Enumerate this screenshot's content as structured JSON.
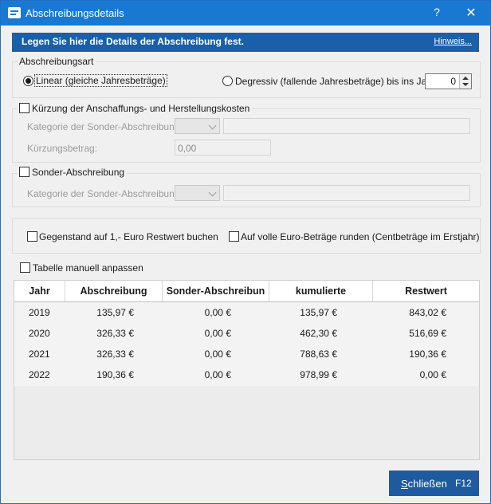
{
  "window": {
    "title": "Abschreibungsdetails",
    "help_label": "?",
    "close_label": "✕",
    "app_icon": "window-app-icon"
  },
  "banner": {
    "text": "Legen Sie hier die Details der Abschreibung fest.",
    "link": "Hinweis..."
  },
  "abschreibungsart": {
    "legend": "Abschreibungsart",
    "linear_label": "Linear (gleiche Jahresbeträge)",
    "linear_checked": true,
    "degressiv_label": "Degressiv (fallende Jahresbeträge) bis ins Jahr:",
    "degressiv_checked": false,
    "bis_jahr_value": "0"
  },
  "kuerzung": {
    "label": "Kürzung der Anschaffungs- und Herstellungskosten",
    "checked": false,
    "kategorie_label": "Kategorie der Sonder-Abschreibung:",
    "kategorie_value": "",
    "kategorie_text": "",
    "betrag_label": "Kürzungsbetrag:",
    "betrag_value": "0,00"
  },
  "sonder": {
    "label": "Sonder-Abschreibung",
    "checked": false,
    "kategorie_label": "Kategorie der Sonder-Abschreibung:",
    "kategorie_value": "",
    "kategorie_text": ""
  },
  "options": {
    "restwert_label": "Gegenstand auf 1,- Euro Restwert buchen",
    "restwert_checked": false,
    "runden_label": "Auf volle Euro-Beträge runden (Centbeträge im Erstjahr)",
    "runden_checked": false
  },
  "tabelle": {
    "manual_label": "Tabelle manuell anpassen",
    "manual_checked": false,
    "columns": [
      "Jahr",
      "Abschreibung",
      "Sonder-Abschreibun",
      "kumulierte",
      "Restwert"
    ],
    "rows": [
      [
        "2019",
        "135,97 €",
        "0,00 €",
        "135,97 €",
        "843,02 €"
      ],
      [
        "2020",
        "326,33 €",
        "0,00 €",
        "462,30 €",
        "516,69 €"
      ],
      [
        "2021",
        "326,33 €",
        "0,00 €",
        "788,63 €",
        "190,36 €"
      ],
      [
        "2022",
        "190,36 €",
        "0,00 €",
        "978,99 €",
        "0,00 €"
      ]
    ]
  },
  "footer": {
    "close_label": "Schließen",
    "close_shortcut": "F12"
  },
  "colors": {
    "titlebar": "#1979d2",
    "banner": "#1a5fa8",
    "primary_button": "#1d5aa0"
  }
}
